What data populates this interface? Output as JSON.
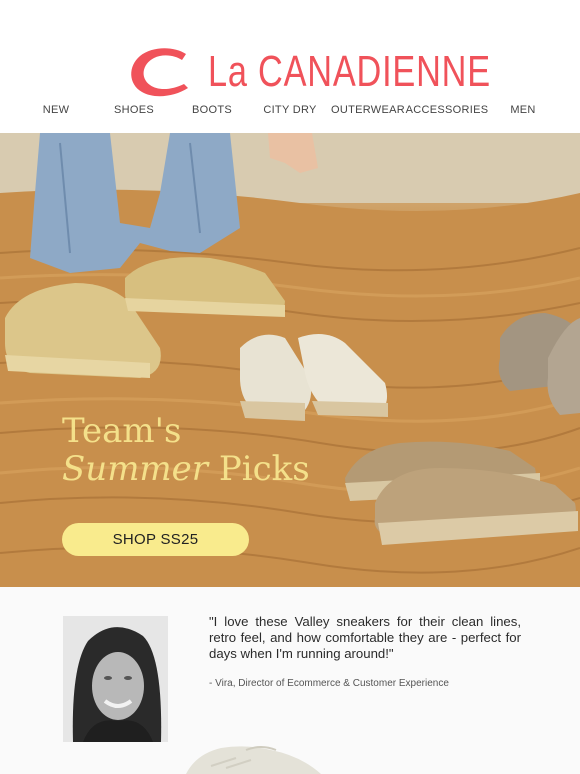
{
  "brand": {
    "name": "La CANADIENNE",
    "accent": "#f0525a"
  },
  "nav": {
    "items": [
      {
        "label": "NEW"
      },
      {
        "label": "SHOES"
      },
      {
        "label": "BOOTS"
      },
      {
        "label": "CITY DRY"
      },
      {
        "label": "OUTERWEAR"
      },
      {
        "label": "ACCESSORIES"
      },
      {
        "label": "MEN"
      }
    ]
  },
  "hero": {
    "title_line1": "Team's",
    "title_line2_italic": "Summer",
    "title_line2_rest": " Picks",
    "cta_label": "SHOP SS25",
    "title_color": "#f4e08a",
    "cta_color": "#f9eb8d"
  },
  "testimonial": {
    "quote": "\"I love these Valley sneakers for their clean lines, retro feel, and how comfortable they are - perfect for days when I'm running around!\"",
    "attribution": "- Vira, Director of Ecommerce & Customer Experience"
  }
}
